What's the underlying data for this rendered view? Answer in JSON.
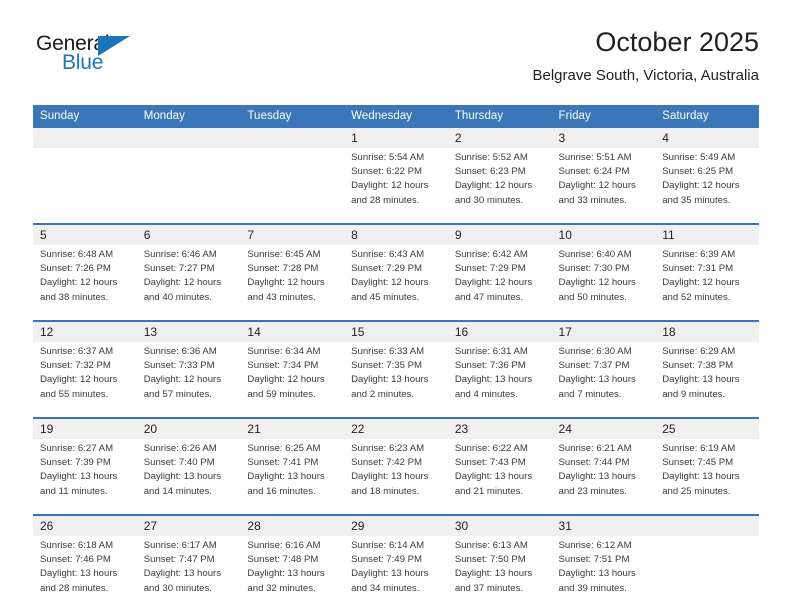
{
  "logo": {
    "word_top": "General",
    "word_bottom": "Blue",
    "accent_color": "#1b75bb",
    "triangle_icon": "triangle-icon"
  },
  "header": {
    "title": "October 2025",
    "subtitle": "Belgrave South, Victoria, Australia"
  },
  "theme": {
    "header_blue": "#3a76b8",
    "daynum_band": "#f0f0f0",
    "text": "#231f20"
  },
  "weekdays": [
    "Sunday",
    "Monday",
    "Tuesday",
    "Wednesday",
    "Thursday",
    "Friday",
    "Saturday"
  ],
  "weeks": [
    [
      {
        "day": "",
        "sunrise": "",
        "sunset": "",
        "daylight_1": "",
        "daylight_2": ""
      },
      {
        "day": "",
        "sunrise": "",
        "sunset": "",
        "daylight_1": "",
        "daylight_2": ""
      },
      {
        "day": "",
        "sunrise": "",
        "sunset": "",
        "daylight_1": "",
        "daylight_2": ""
      },
      {
        "day": "1",
        "sunrise": "Sunrise: 5:54 AM",
        "sunset": "Sunset: 6:22 PM",
        "daylight_1": "Daylight: 12 hours",
        "daylight_2": "and 28 minutes."
      },
      {
        "day": "2",
        "sunrise": "Sunrise: 5:52 AM",
        "sunset": "Sunset: 6:23 PM",
        "daylight_1": "Daylight: 12 hours",
        "daylight_2": "and 30 minutes."
      },
      {
        "day": "3",
        "sunrise": "Sunrise: 5:51 AM",
        "sunset": "Sunset: 6:24 PM",
        "daylight_1": "Daylight: 12 hours",
        "daylight_2": "and 33 minutes."
      },
      {
        "day": "4",
        "sunrise": "Sunrise: 5:49 AM",
        "sunset": "Sunset: 6:25 PM",
        "daylight_1": "Daylight: 12 hours",
        "daylight_2": "and 35 minutes."
      }
    ],
    [
      {
        "day": "5",
        "sunrise": "Sunrise: 6:48 AM",
        "sunset": "Sunset: 7:26 PM",
        "daylight_1": "Daylight: 12 hours",
        "daylight_2": "and 38 minutes."
      },
      {
        "day": "6",
        "sunrise": "Sunrise: 6:46 AM",
        "sunset": "Sunset: 7:27 PM",
        "daylight_1": "Daylight: 12 hours",
        "daylight_2": "and 40 minutes."
      },
      {
        "day": "7",
        "sunrise": "Sunrise: 6:45 AM",
        "sunset": "Sunset: 7:28 PM",
        "daylight_1": "Daylight: 12 hours",
        "daylight_2": "and 43 minutes."
      },
      {
        "day": "8",
        "sunrise": "Sunrise: 6:43 AM",
        "sunset": "Sunset: 7:29 PM",
        "daylight_1": "Daylight: 12 hours",
        "daylight_2": "and 45 minutes."
      },
      {
        "day": "9",
        "sunrise": "Sunrise: 6:42 AM",
        "sunset": "Sunset: 7:29 PM",
        "daylight_1": "Daylight: 12 hours",
        "daylight_2": "and 47 minutes."
      },
      {
        "day": "10",
        "sunrise": "Sunrise: 6:40 AM",
        "sunset": "Sunset: 7:30 PM",
        "daylight_1": "Daylight: 12 hours",
        "daylight_2": "and 50 minutes."
      },
      {
        "day": "11",
        "sunrise": "Sunrise: 6:39 AM",
        "sunset": "Sunset: 7:31 PM",
        "daylight_1": "Daylight: 12 hours",
        "daylight_2": "and 52 minutes."
      }
    ],
    [
      {
        "day": "12",
        "sunrise": "Sunrise: 6:37 AM",
        "sunset": "Sunset: 7:32 PM",
        "daylight_1": "Daylight: 12 hours",
        "daylight_2": "and 55 minutes."
      },
      {
        "day": "13",
        "sunrise": "Sunrise: 6:36 AM",
        "sunset": "Sunset: 7:33 PM",
        "daylight_1": "Daylight: 12 hours",
        "daylight_2": "and 57 minutes."
      },
      {
        "day": "14",
        "sunrise": "Sunrise: 6:34 AM",
        "sunset": "Sunset: 7:34 PM",
        "daylight_1": "Daylight: 12 hours",
        "daylight_2": "and 59 minutes."
      },
      {
        "day": "15",
        "sunrise": "Sunrise: 6:33 AM",
        "sunset": "Sunset: 7:35 PM",
        "daylight_1": "Daylight: 13 hours",
        "daylight_2": "and 2 minutes."
      },
      {
        "day": "16",
        "sunrise": "Sunrise: 6:31 AM",
        "sunset": "Sunset: 7:36 PM",
        "daylight_1": "Daylight: 13 hours",
        "daylight_2": "and 4 minutes."
      },
      {
        "day": "17",
        "sunrise": "Sunrise: 6:30 AM",
        "sunset": "Sunset: 7:37 PM",
        "daylight_1": "Daylight: 13 hours",
        "daylight_2": "and 7 minutes."
      },
      {
        "day": "18",
        "sunrise": "Sunrise: 6:29 AM",
        "sunset": "Sunset: 7:38 PM",
        "daylight_1": "Daylight: 13 hours",
        "daylight_2": "and 9 minutes."
      }
    ],
    [
      {
        "day": "19",
        "sunrise": "Sunrise: 6:27 AM",
        "sunset": "Sunset: 7:39 PM",
        "daylight_1": "Daylight: 13 hours",
        "daylight_2": "and 11 minutes."
      },
      {
        "day": "20",
        "sunrise": "Sunrise: 6:26 AM",
        "sunset": "Sunset: 7:40 PM",
        "daylight_1": "Daylight: 13 hours",
        "daylight_2": "and 14 minutes."
      },
      {
        "day": "21",
        "sunrise": "Sunrise: 6:25 AM",
        "sunset": "Sunset: 7:41 PM",
        "daylight_1": "Daylight: 13 hours",
        "daylight_2": "and 16 minutes."
      },
      {
        "day": "22",
        "sunrise": "Sunrise: 6:23 AM",
        "sunset": "Sunset: 7:42 PM",
        "daylight_1": "Daylight: 13 hours",
        "daylight_2": "and 18 minutes."
      },
      {
        "day": "23",
        "sunrise": "Sunrise: 6:22 AM",
        "sunset": "Sunset: 7:43 PM",
        "daylight_1": "Daylight: 13 hours",
        "daylight_2": "and 21 minutes."
      },
      {
        "day": "24",
        "sunrise": "Sunrise: 6:21 AM",
        "sunset": "Sunset: 7:44 PM",
        "daylight_1": "Daylight: 13 hours",
        "daylight_2": "and 23 minutes."
      },
      {
        "day": "25",
        "sunrise": "Sunrise: 6:19 AM",
        "sunset": "Sunset: 7:45 PM",
        "daylight_1": "Daylight: 13 hours",
        "daylight_2": "and 25 minutes."
      }
    ],
    [
      {
        "day": "26",
        "sunrise": "Sunrise: 6:18 AM",
        "sunset": "Sunset: 7:46 PM",
        "daylight_1": "Daylight: 13 hours",
        "daylight_2": "and 28 minutes."
      },
      {
        "day": "27",
        "sunrise": "Sunrise: 6:17 AM",
        "sunset": "Sunset: 7:47 PM",
        "daylight_1": "Daylight: 13 hours",
        "daylight_2": "and 30 minutes."
      },
      {
        "day": "28",
        "sunrise": "Sunrise: 6:16 AM",
        "sunset": "Sunset: 7:48 PM",
        "daylight_1": "Daylight: 13 hours",
        "daylight_2": "and 32 minutes."
      },
      {
        "day": "29",
        "sunrise": "Sunrise: 6:14 AM",
        "sunset": "Sunset: 7:49 PM",
        "daylight_1": "Daylight: 13 hours",
        "daylight_2": "and 34 minutes."
      },
      {
        "day": "30",
        "sunrise": "Sunrise: 6:13 AM",
        "sunset": "Sunset: 7:50 PM",
        "daylight_1": "Daylight: 13 hours",
        "daylight_2": "and 37 minutes."
      },
      {
        "day": "31",
        "sunrise": "Sunrise: 6:12 AM",
        "sunset": "Sunset: 7:51 PM",
        "daylight_1": "Daylight: 13 hours",
        "daylight_2": "and 39 minutes."
      },
      {
        "day": "",
        "sunrise": "",
        "sunset": "",
        "daylight_1": "",
        "daylight_2": ""
      }
    ]
  ]
}
